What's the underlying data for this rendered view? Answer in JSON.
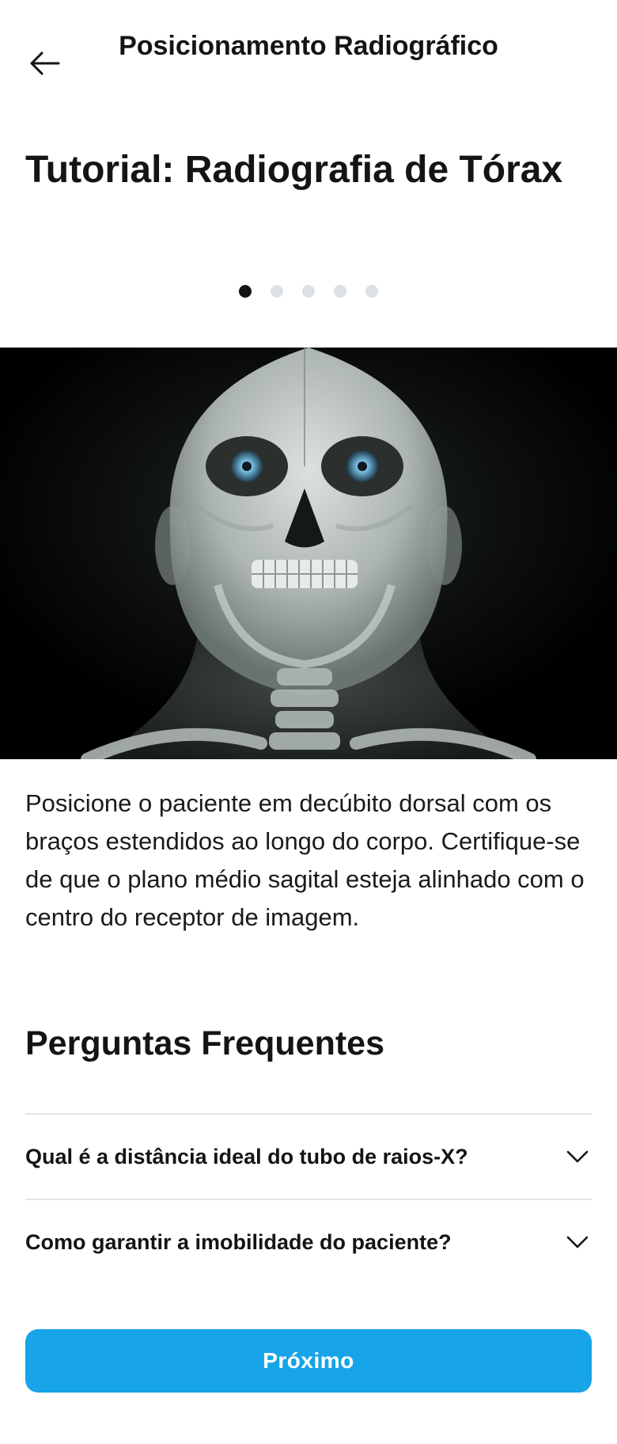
{
  "header": {
    "title": "Posicionamento Radiográfico",
    "back_icon": "arrow-left-icon"
  },
  "tutorial": {
    "title": "Tutorial: Radiografia de Tórax",
    "steps_total": 5,
    "current_step": 1,
    "image": "chest-x-ray-skull-illustration",
    "description": "Posicione o paciente em decúbito dorsal com os braços estendidos ao longo do corpo. Certifique-se de que o plano médio sagital esteja alinhado com o centro do receptor de imagem."
  },
  "faq": {
    "heading": "Perguntas Frequentes",
    "items": [
      {
        "question": "Qual é a distância ideal do tubo de raios-X?",
        "icon": "chevron-down-icon"
      },
      {
        "question": "Como garantir a imobilidade do paciente?",
        "icon": "chevron-down-icon"
      }
    ]
  },
  "actions": {
    "next_label": "Próximo"
  },
  "colors": {
    "primary": "#17a4e8",
    "text": "#141414",
    "dot_inactive": "#dde1e5",
    "divider": "#e3e5e8"
  }
}
